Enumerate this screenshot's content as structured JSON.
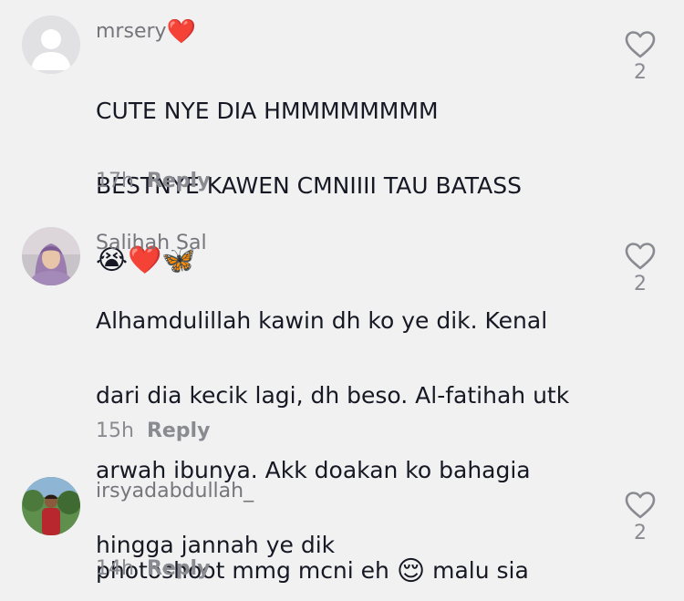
{
  "comments": [
    {
      "username": "mrsery",
      "username_emoji": "❤️",
      "text_lines": [
        "CUTE NYE DIA HMMMMMMMM",
        "BESTNYE KAWEN CMNIIII TAU BATASS"
      ],
      "text_emoji": "😭❤️🦋",
      "time": "17h",
      "reply_label": "Reply",
      "likes": "2",
      "avatar": "default-avatar-icon"
    },
    {
      "username": "Salihah Sal",
      "text_lines": [
        "Alhamdulillah kawin dh ko ye dik. Kenal",
        "dari dia kecik lagi, dh beso. Al-fatihah utk",
        "arwah ibunya. Akk doakan ko bahagia",
        "hingga jannah ye dik"
      ],
      "time": "15h",
      "reply_label": "Reply",
      "likes": "2",
      "avatar": "profile-photo"
    },
    {
      "username": "irsyadabdullah_",
      "text_before": "photoshoot mmg mcni eh ",
      "text_emoji": "😌",
      "text_after": " malu sia",
      "time": "14h",
      "reply_label": "Reply",
      "likes": "2",
      "avatar": "profile-photo"
    }
  ]
}
